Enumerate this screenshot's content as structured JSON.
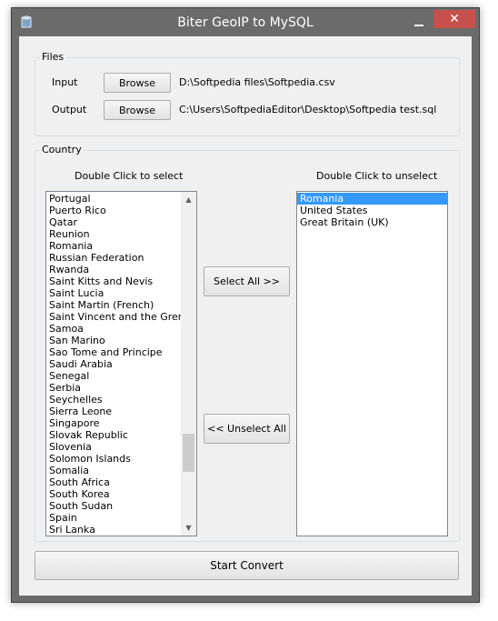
{
  "window": {
    "title": "Biter GeoIP to MySQL",
    "close_glyph": "✕"
  },
  "files": {
    "legend": "Files",
    "input_label": "Input",
    "output_label": "Output",
    "browse_label": "Browse",
    "input_path": "D:\\Softpedia files\\Softpedia.csv",
    "output_path": "C:\\Users\\SoftpediaEditor\\Desktop\\Softpedia test.sql"
  },
  "country": {
    "legend": "Country",
    "available_header": "Double Click to select",
    "selected_header": "Double Click to unselect",
    "available": [
      "Portugal",
      "Puerto Rico",
      "Qatar",
      "Reunion",
      "Romania",
      "Russian Federation",
      "Rwanda",
      "Saint Kitts and Nevis",
      "Saint Lucia",
      "Saint Martin (French)",
      "Saint Vincent and the Grenadines",
      "Samoa",
      "San Marino",
      "Sao Tome and Principe",
      "Saudi Arabia",
      "Senegal",
      "Serbia",
      "Seychelles",
      "Sierra Leone",
      "Singapore",
      "Slovak Republic",
      "Slovenia",
      "Solomon Islands",
      "Somalia",
      "South Africa",
      "South Korea",
      "South Sudan",
      "Spain",
      "Sri Lanka"
    ],
    "selected": [
      "Romania",
      "United States",
      "Great Britain (UK)"
    ],
    "select_all_label": "Select All >>",
    "unselect_all_label": "<< Unselect All"
  },
  "start_label": "Start Convert",
  "colors": {
    "selection": "#3399ff",
    "close_button": "#c7504c",
    "frame": "#6b6b6b"
  },
  "icons": {
    "app": "database-icon",
    "scroll_up": "chevron-up-icon",
    "scroll_down": "chevron-down-icon"
  }
}
